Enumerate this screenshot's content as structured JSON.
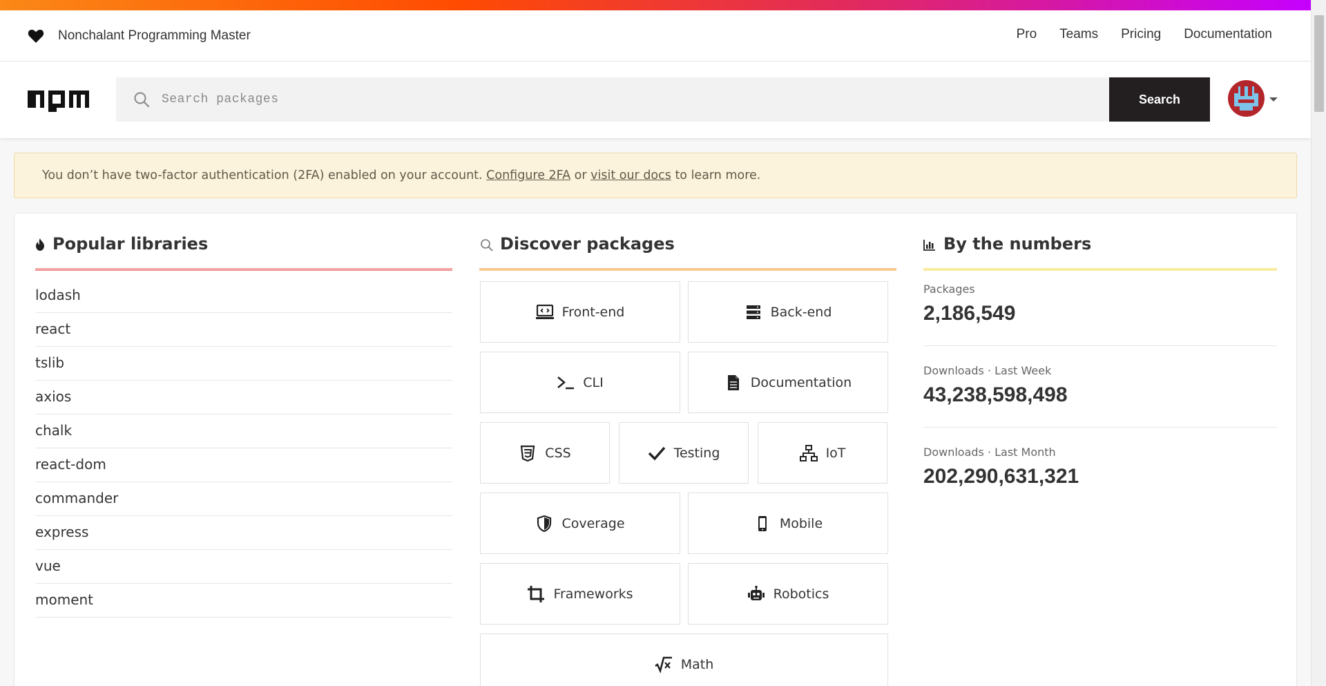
{
  "topnav": {
    "tagline": "Nonchalant Programming Master",
    "links": [
      "Pro",
      "Teams",
      "Pricing",
      "Documentation"
    ]
  },
  "search": {
    "placeholder": "Search packages",
    "button_label": "Search"
  },
  "banner": {
    "text_before": "You don’t have two-factor authentication (2FA) enabled on your account. ",
    "link1": "Configure 2FA",
    "text_middle": " or ",
    "link2": "visit our docs",
    "text_after": " to learn more."
  },
  "popular": {
    "title": "Popular libraries",
    "items": [
      "lodash",
      "react",
      "tslib",
      "axios",
      "chalk",
      "react-dom",
      "commander",
      "express",
      "vue",
      "moment"
    ]
  },
  "discover": {
    "title": "Discover packages",
    "tiles": [
      {
        "label": "Front-end",
        "icon": "monitor-code-icon"
      },
      {
        "label": "Back-end",
        "icon": "server-icon"
      },
      {
        "label": "CLI",
        "icon": "terminal-icon"
      },
      {
        "label": "Documentation",
        "icon": "document-icon"
      },
      {
        "label": "CSS",
        "icon": "css3-icon"
      },
      {
        "label": "Testing",
        "icon": "checkmark-icon"
      },
      {
        "label": "IoT",
        "icon": "network-icon"
      },
      {
        "label": "Coverage",
        "icon": "shield-icon"
      },
      {
        "label": "Mobile",
        "icon": "mobile-icon"
      },
      {
        "label": "Frameworks",
        "icon": "crop-icon"
      },
      {
        "label": "Robotics",
        "icon": "robot-icon"
      },
      {
        "label": "Math",
        "icon": "square-root-icon"
      }
    ]
  },
  "numbers": {
    "title": "By the numbers",
    "stats": [
      {
        "label": "Packages",
        "value": "2,186,549"
      },
      {
        "label": "Downloads · Last Week",
        "value": "43,238,598,498"
      },
      {
        "label": "Downloads · Last Month",
        "value": "202,290,631,321"
      }
    ]
  },
  "colors": {
    "popular_rule": "#f3a6a6",
    "discover_rule": "#f7c98f",
    "numbers_rule": "#f9ec9d"
  }
}
